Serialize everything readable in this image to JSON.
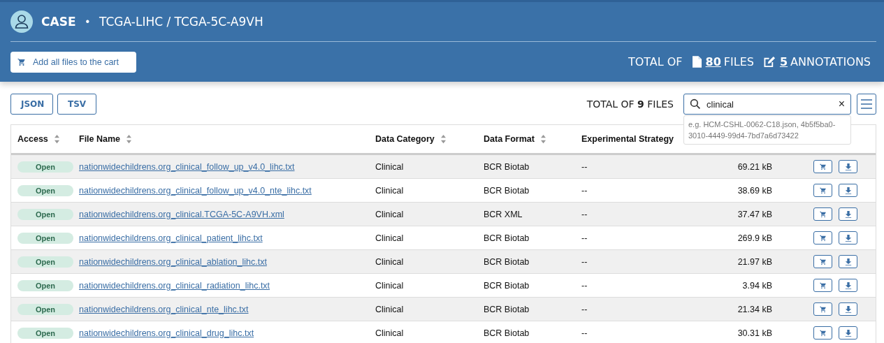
{
  "header": {
    "kind_label": "CASE",
    "separator": "•",
    "title": "TCGA-LIHC / TCGA-5C-A9VH",
    "add_button": "Add all files to the cart",
    "totals": {
      "prefix": "TOTAL OF",
      "files_count": "80",
      "files_label": "FILES",
      "annotations_count": "5",
      "annotations_label": "ANNOTATIONS"
    }
  },
  "files": {
    "export_buttons": [
      "JSON",
      "TSV"
    ],
    "total": {
      "prefix": "TOTAL OF",
      "count": "9",
      "suffix": "FILES"
    },
    "search": {
      "value": "clinical",
      "clear": "×",
      "suggestion": "e.g. HCM-CSHL-0062-C18.json, 4b5f5ba0-3010-4449-99d4-7bd7a6d73422"
    },
    "table": {
      "columns": [
        {
          "label": "Access",
          "sortable": true
        },
        {
          "label": "File Name",
          "sortable": true
        },
        {
          "label": "Data Category",
          "sortable": true
        },
        {
          "label": "Data Format",
          "sortable": true
        },
        {
          "label": "Experimental Strategy",
          "sortable": false
        }
      ],
      "rows": [
        {
          "access": "Open",
          "file_name": "nationwidechildrens.org_clinical_follow_up_v4.0_lihc.txt",
          "category": "Clinical",
          "format": "BCR Biotab",
          "strategy": "--",
          "size": "69.21 kB"
        },
        {
          "access": "Open",
          "file_name": "nationwidechildrens.org_clinical_follow_up_v4.0_nte_lihc.txt",
          "category": "Clinical",
          "format": "BCR Biotab",
          "strategy": "--",
          "size": "38.69 kB"
        },
        {
          "access": "Open",
          "file_name": "nationwidechildrens.org_clinical.TCGA-5C-A9VH.xml",
          "category": "Clinical",
          "format": "BCR XML",
          "strategy": "--",
          "size": "37.47 kB"
        },
        {
          "access": "Open",
          "file_name": "nationwidechildrens.org_clinical_patient_lihc.txt",
          "category": "Clinical",
          "format": "BCR Biotab",
          "strategy": "--",
          "size": "269.9 kB"
        },
        {
          "access": "Open",
          "file_name": "nationwidechildrens.org_clinical_ablation_lihc.txt",
          "category": "Clinical",
          "format": "BCR Biotab",
          "strategy": "--",
          "size": "21.97 kB"
        },
        {
          "access": "Open",
          "file_name": "nationwidechildrens.org_clinical_radiation_lihc.txt",
          "category": "Clinical",
          "format": "BCR Biotab",
          "strategy": "--",
          "size": "3.94 kB"
        },
        {
          "access": "Open",
          "file_name": "nationwidechildrens.org_clinical_nte_lihc.txt",
          "category": "Clinical",
          "format": "BCR Biotab",
          "strategy": "--",
          "size": "21.34 kB"
        },
        {
          "access": "Open",
          "file_name": "nationwidechildrens.org_clinical_drug_lihc.txt",
          "category": "Clinical",
          "format": "BCR Biotab",
          "strategy": "--",
          "size": "30.31 kB"
        }
      ]
    }
  }
}
